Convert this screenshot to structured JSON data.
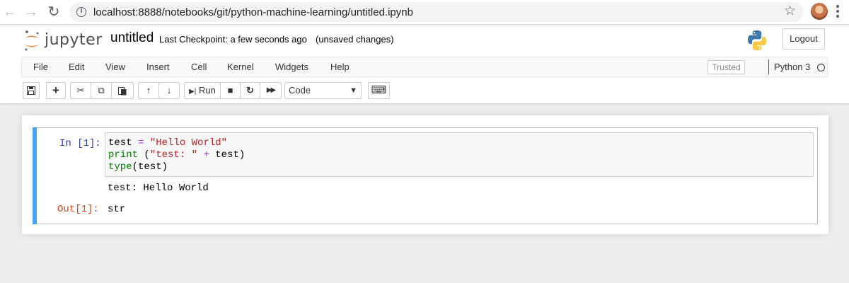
{
  "browser": {
    "url": "localhost:8888/notebooks/git/python-machine-learning/untitled.ipynb",
    "back_icon": "←",
    "forward_icon": "→",
    "reload_icon": "↻",
    "info_icon": "i",
    "star_icon": "☆"
  },
  "header": {
    "logo_text": "jupyter",
    "notebook_name": "untitled",
    "checkpoint": "Last Checkpoint: a few seconds ago",
    "unsaved": "(unsaved changes)",
    "logout_label": "Logout"
  },
  "menubar": {
    "items": [
      "File",
      "Edit",
      "View",
      "Insert",
      "Cell",
      "Kernel",
      "Widgets",
      "Help"
    ],
    "trusted_label": "Trusted",
    "kernel_name": "Python 3"
  },
  "toolbar": {
    "save_icon": "💾",
    "add_icon": "+",
    "cut_icon": "✂",
    "copy_icon": "⧉",
    "paste_icon": "📋",
    "up_icon": "↑",
    "down_icon": "↓",
    "run_label": "Run",
    "run_icon": "▶|",
    "stop_icon": "■",
    "restart_icon": "↻",
    "fast_forward_icon": "▶▶",
    "cell_type": "Code",
    "keyboard_icon": "⌨"
  },
  "cell": {
    "prompt_in": "In [1]:",
    "code_lines": [
      {
        "parts": [
          {
            "t": "test ",
            "c": ""
          },
          {
            "t": "=",
            "c": "op"
          },
          {
            "t": " ",
            "c": ""
          },
          {
            "t": "\"Hello World\"",
            "c": "str"
          }
        ]
      },
      {
        "parts": [
          {
            "t": "print",
            "c": "kw"
          },
          {
            "t": " (",
            "c": ""
          },
          {
            "t": "\"test: \"",
            "c": "str"
          },
          {
            "t": " ",
            "c": ""
          },
          {
            "t": "+",
            "c": "op"
          },
          {
            "t": " test)",
            "c": ""
          }
        ]
      },
      {
        "parts": [
          {
            "t": "type",
            "c": "kw"
          },
          {
            "t": "(test)",
            "c": ""
          }
        ]
      }
    ],
    "stdout": "test: Hello World",
    "prompt_out": "Out[1]:",
    "result": "str"
  },
  "colors": {
    "cell_selected_bar": "#42a5f5",
    "prompt_in": "#303f9f",
    "prompt_out": "#d84315"
  }
}
